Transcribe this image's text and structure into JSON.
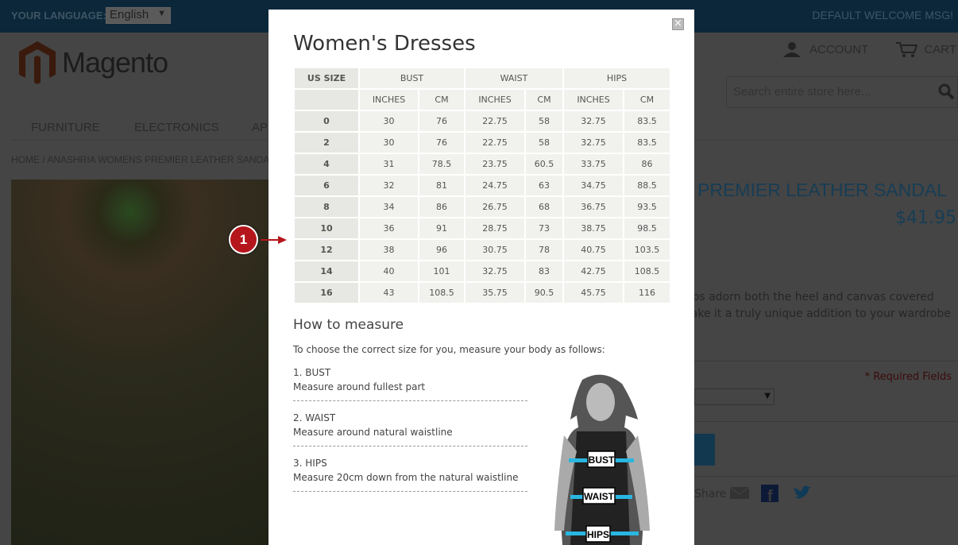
{
  "topbar": {
    "language_label": "YOUR LANGUAGE:",
    "language_value": "English",
    "welcome": "DEFAULT WELCOME MSG!"
  },
  "header": {
    "logo": "Magento",
    "account": "ACCOUNT",
    "cart": "CART",
    "search_placeholder": "Search entire store here..."
  },
  "nav": [
    "FURNITURE",
    "ELECTRONICS",
    "APPAREL"
  ],
  "breadcrumb": "HOME  /  ANASHRIA WOMENS PREMIER LEATHER SANDAL",
  "product": {
    "title": "ANASHRIA WOMENS PREMIER LEATHER SANDAL",
    "price": "$41.95",
    "desc_line1": "Beaded straps adorn both the heel and canvas covered",
    "desc_line2": "wedge to make it a truly unique addition to your wardrobe",
    "required": "* Required Fields",
    "share": "Share"
  },
  "modal": {
    "title": "Women's Dresses",
    "close": "×",
    "table": {
      "size_header": "US SIZE",
      "groups": [
        "BUST",
        "WAIST",
        "HIPS"
      ],
      "units": [
        "INCHES",
        "CM",
        "INCHES",
        "CM",
        "INCHES",
        "CM"
      ],
      "rows": [
        [
          "0",
          "30",
          "76",
          "22.75",
          "58",
          "32.75",
          "83.5"
        ],
        [
          "2",
          "30",
          "76",
          "22.75",
          "58",
          "32.75",
          "83.5"
        ],
        [
          "4",
          "31",
          "78.5",
          "23.75",
          "60.5",
          "33.75",
          "86"
        ],
        [
          "6",
          "32",
          "81",
          "24.75",
          "63",
          "34.75",
          "88.5"
        ],
        [
          "8",
          "34",
          "86",
          "26.75",
          "68",
          "36.75",
          "93.5"
        ],
        [
          "10",
          "36",
          "91",
          "28.75",
          "73",
          "38.75",
          "98.5"
        ],
        [
          "12",
          "38",
          "96",
          "30.75",
          "78",
          "40.75",
          "103.5"
        ],
        [
          "14",
          "40",
          "101",
          "32.75",
          "83",
          "42.75",
          "108.5"
        ],
        [
          "16",
          "43",
          "108.5",
          "35.75",
          "90.5",
          "45.75",
          "116"
        ]
      ]
    },
    "how_title": "How to measure",
    "intro": "To choose the correct size for you, measure your body as follows:",
    "steps": [
      {
        "title": "1. BUST",
        "text": "Measure around fullest part"
      },
      {
        "title": "2. WAIST",
        "text": "Measure around natural waistline"
      },
      {
        "title": "3. HIPS",
        "text": "Measure 20cm down from the natural waistline"
      }
    ],
    "figure_labels": [
      "BUST",
      "WAIST",
      "HIPS"
    ]
  },
  "callout": {
    "number": "1",
    "color": "#b5161b"
  },
  "colors": {
    "accent": "#1979c3",
    "band": "#29b6e0"
  }
}
